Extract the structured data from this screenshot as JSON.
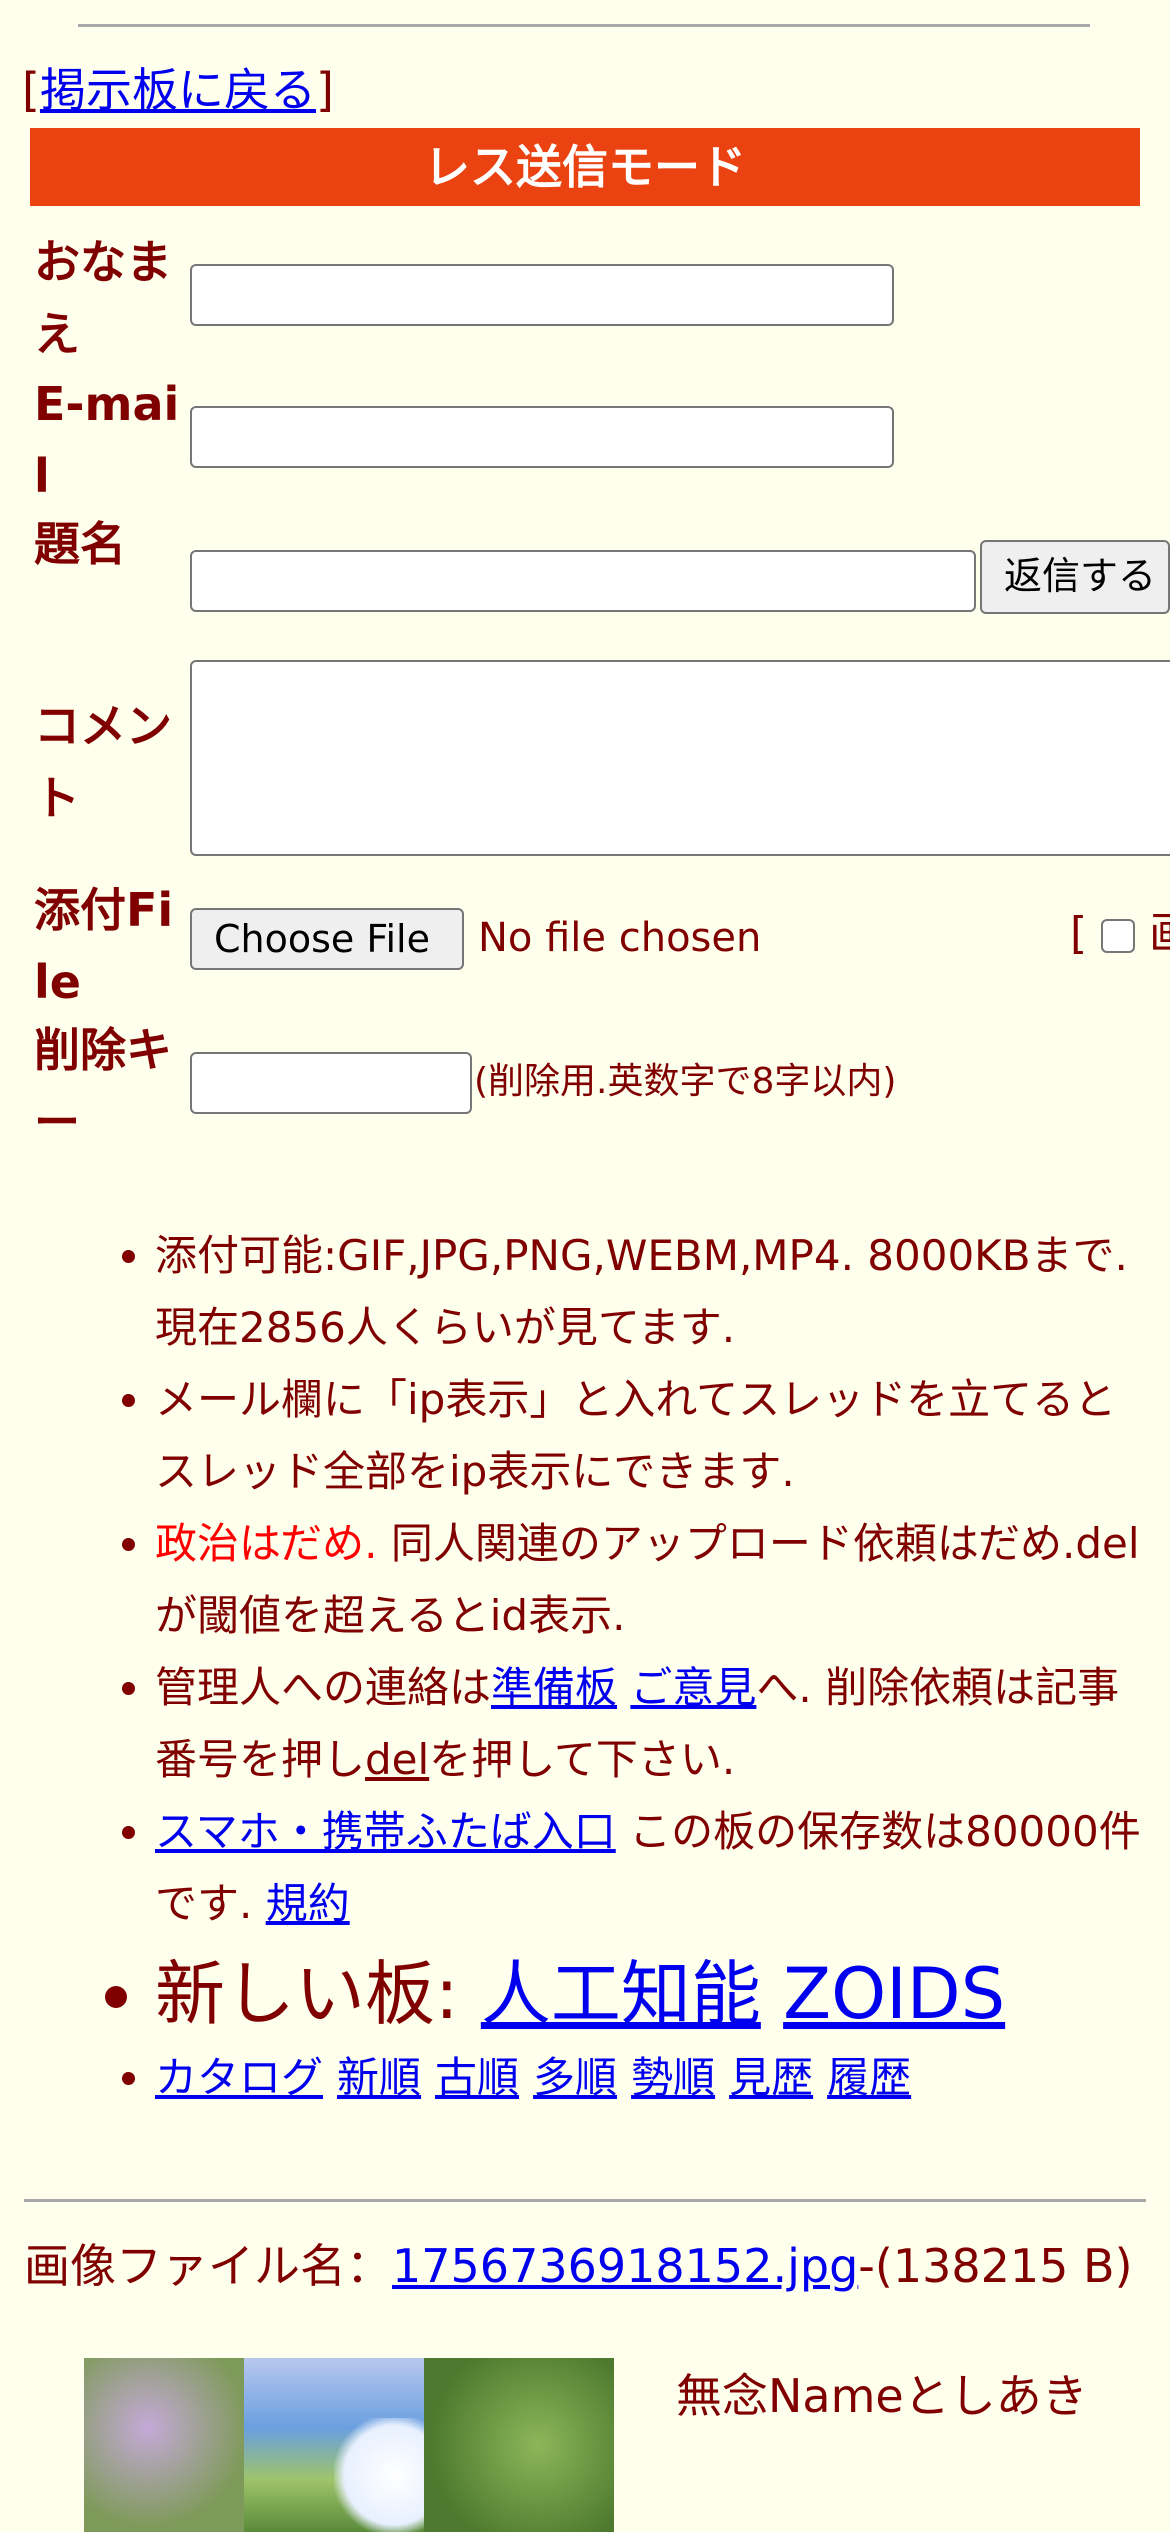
{
  "nav": {
    "back_open": "[",
    "back_link": "掲示板に戻る",
    "back_close": "]"
  },
  "mode_title": "レス送信モード",
  "form": {
    "name_label": "おなまえ",
    "email_label": "E-mail",
    "subject_label": "題名",
    "comment_label": "コメント",
    "file_label": "添付File",
    "delkey_label": "削除キー",
    "submit_button": "返信する",
    "choose_file_button": "Choose File",
    "no_file_text": "No file chosen",
    "image_option_prefix": "[",
    "image_option_label": "画",
    "delkey_hint": "(削除用.英数字で8字以内)"
  },
  "notes": {
    "line1": "添付可能:GIF,JPG,PNG,WEBM,MP4. 8000KBまで. 現在2856人くらいが見てます.",
    "line2": "メール欄に「ip表示」と入れてスレッドを立てるとスレッド全部をip表示にできます.",
    "line3_red": "政治はだめ.",
    "line3_rest": " 同人関連のアップロード依頼はだめ.delが閾値を超えるとid表示.",
    "line4_a": "管理人への連絡は",
    "line4_link1": "準備板",
    "line4_link2": "ご意見",
    "line4_b": "へ. 削除依頼は記事番号を押し",
    "line4_del": "del",
    "line4_c": "を押して下さい.",
    "line5_link": "スマホ・携帯ふたば入口",
    "line5_text": " この板の保存数は80000件です. ",
    "line5_rules": "規約",
    "new_boards_label": "新しい板: ",
    "new_board1": "人工知能",
    "new_board2": "ZOIDS",
    "sort_links": [
      "カタログ",
      "新順",
      "古順",
      "多順",
      "勢順",
      "見歴",
      "履歴"
    ]
  },
  "post": {
    "file_label": "画像ファイル名：",
    "file_name": "1756736918152.jpg",
    "file_size": "-(138215 B)",
    "poster_text": "無念Nameとしあき"
  }
}
